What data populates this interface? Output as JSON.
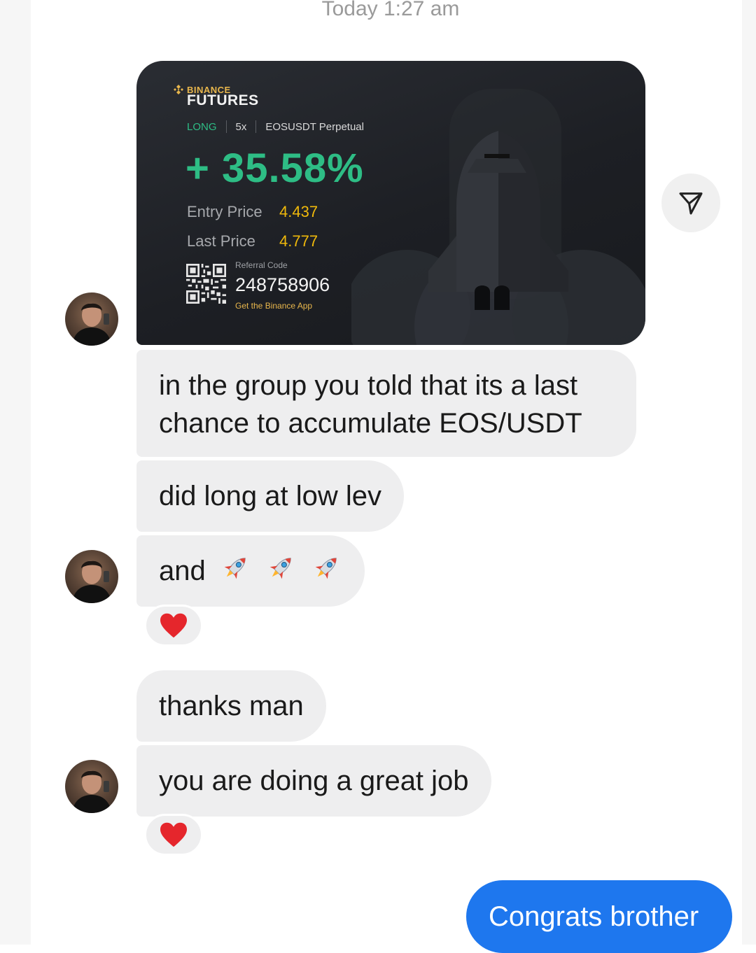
{
  "header": {
    "timestamp": "Today 1:27 am"
  },
  "card": {
    "brand_top": "BINANCE",
    "brand_main": "FUTURES",
    "side": "LONG",
    "leverage": "5x",
    "symbol": "EOSUSDT Perpetual",
    "pnl": "+ 35.58%",
    "entry_label": "Entry Price",
    "entry_value": "4.437",
    "last_label": "Last Price",
    "last_value": "4.777",
    "referral_label": "Referral Code",
    "referral_code": "248758906",
    "app_text": "Get the Binance App"
  },
  "messages": {
    "m1": "in the group you told that its a last chance to accumulate EOS/USDT",
    "m2": "did long at low lev",
    "m3": "and",
    "m4": "thanks man",
    "m5": "you are doing a great job",
    "outgoing": "Congrats brother"
  },
  "reactions": [
    "heart",
    "heart"
  ],
  "icons": {
    "share": "share-arrow-icon",
    "rocket": "rocket-emoji-icon",
    "heart": "heart-emoji-icon"
  },
  "colors": {
    "accent_green": "#2ebd85",
    "binance_gold": "#f0b90b",
    "outgoing_bubble": "#1e77ee",
    "incoming_bubble": "#eeeeef"
  }
}
